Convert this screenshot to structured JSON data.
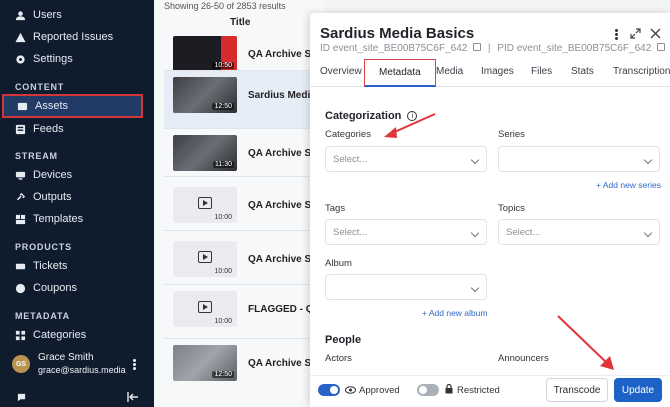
{
  "sidebar": {
    "items": [
      {
        "label": "Users",
        "icon": "user-icon"
      },
      {
        "label": "Reported Issues",
        "icon": "warning-icon"
      },
      {
        "label": "Settings",
        "icon": "gear-icon"
      }
    ],
    "content_heading": "CONTENT",
    "content_items": [
      {
        "label": "Assets",
        "icon": "assets-icon"
      },
      {
        "label": "Feeds",
        "icon": "feeds-icon"
      }
    ],
    "stream_heading": "STREAM",
    "stream_items": [
      {
        "label": "Devices",
        "icon": "device-icon"
      },
      {
        "label": "Outputs",
        "icon": "link-icon"
      },
      {
        "label": "Templates",
        "icon": "template-icon"
      }
    ],
    "products_heading": "PRODUCTS",
    "products_items": [
      {
        "label": "Tickets",
        "icon": "ticket-icon"
      },
      {
        "label": "Coupons",
        "icon": "coupon-icon"
      }
    ],
    "metadata_heading": "METADATA",
    "metadata_items": [
      {
        "label": "Categories",
        "icon": "grid-icon"
      }
    ],
    "user": {
      "initials": "GS",
      "name": "Grace Smith",
      "email": "grace@sardius.media"
    }
  },
  "list": {
    "results": "Showing 26-50 of 2853 results",
    "title_header": "Title",
    "rows": [
      {
        "title": "QA Archive Sett",
        "duration": "10:50"
      },
      {
        "title": "Sardius Media B",
        "duration": "12:50"
      },
      {
        "title": "QA Archive Sett",
        "duration": "11:30"
      },
      {
        "title": "QA Archive Sett",
        "duration": "10:00"
      },
      {
        "title": "QA Archive Sett",
        "duration": "10:00"
      },
      {
        "title": "FLAGGED - QA A",
        "duration": "10:00"
      },
      {
        "title": "QA Archive Sett",
        "duration": "12:50"
      }
    ]
  },
  "panel": {
    "title": "Sardius Media Basics",
    "id_text": "ID event_site_BE00B75C6F_642",
    "pid_text": "PID event_site_BE00B75C6F_642",
    "separator": "|",
    "tabs": [
      "Overview",
      "Metadata",
      "Media",
      "Images",
      "Files",
      "Stats",
      "Transcriptions"
    ],
    "active_tab": "Metadata",
    "categorization_heading": "Categorization",
    "categories_label": "Categories",
    "categories_placeholder": "Select...",
    "series_label": "Series",
    "series_placeholder": "",
    "add_series": "+ Add new series",
    "tags_label": "Tags",
    "tags_placeholder": "Select...",
    "topics_label": "Topics",
    "topics_placeholder": "Select...",
    "album_label": "Album",
    "album_placeholder": "",
    "add_album": "+ Add new album",
    "people_heading": "People",
    "actors_label": "Actors",
    "announcers_label": "Announcers",
    "approved_label": "Approved",
    "approved_on": true,
    "restricted_label": "Restricted",
    "restricted_on": false,
    "transcode_label": "Transcode",
    "update_label": "Update"
  },
  "colors": {
    "accent": "#1d62c6",
    "sidebar": "#0f1c2e",
    "highlight": "#e0353a"
  }
}
